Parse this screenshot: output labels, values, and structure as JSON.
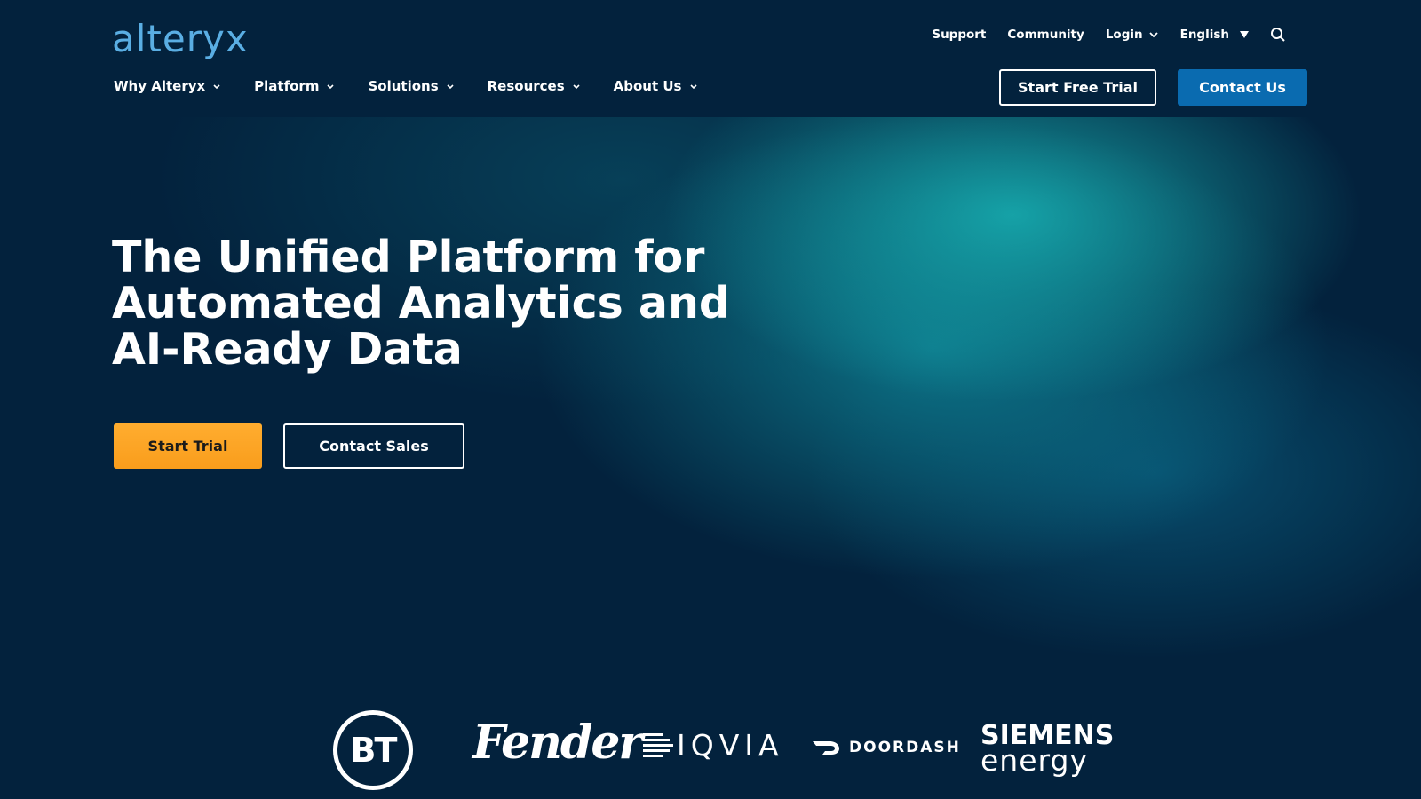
{
  "brand": {
    "logo_text": "alteryx",
    "logo_color": "#5aaee3"
  },
  "utility_nav": {
    "support": "Support",
    "community": "Community",
    "login": "Login",
    "language": "English"
  },
  "main_nav": {
    "items": [
      {
        "label": "Why Alteryx"
      },
      {
        "label": "Platform"
      },
      {
        "label": "Solutions"
      },
      {
        "label": "Resources"
      },
      {
        "label": "About Us"
      }
    ]
  },
  "header_buttons": {
    "free_trial": "Start Free Trial",
    "contact_us": "Contact Us"
  },
  "hero": {
    "title_line1": "The Unified Platform for",
    "title_line2": "Automated Analytics and",
    "title_line3": "AI-Ready Data",
    "primary_button": "Start Trial",
    "secondary_button": "Contact Sales"
  },
  "customer_logos": {
    "bt": "BT",
    "fender": "Fender",
    "iqvia": "IQVIA",
    "doordash": "DOORDASH",
    "siemens_line1": "SIEMENS",
    "siemens_line2": "energy"
  },
  "colors": {
    "background": "#03223d",
    "accent_orange": "#f99d1c",
    "accent_blue": "#0a6bb0",
    "teal_glow": "#18b2b4"
  },
  "icons": {
    "search": "search-icon",
    "chevron": "chevron-down-icon",
    "dropdown": "caret-down-icon"
  }
}
